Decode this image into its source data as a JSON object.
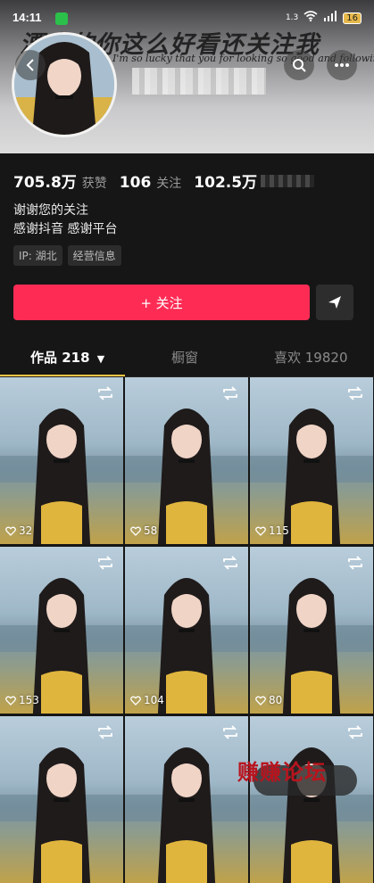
{
  "status_bar": {
    "time": "14:11",
    "signal": "1.3",
    "battery": "16"
  },
  "header": {
    "slogan": "漂亮的你这么好看还关注我",
    "slogan_en": "I'm so lucky that you for looking so good and following me"
  },
  "stats": [
    {
      "value": "705.8万",
      "label": "获赞"
    },
    {
      "value": "106",
      "label": "关注"
    },
    {
      "value": "102.5万",
      "label": ""
    }
  ],
  "bio": [
    "谢谢您的关注",
    "感谢抖音 感谢平台"
  ],
  "tags": [
    "IP: 湖北",
    "经营信息"
  ],
  "actions": {
    "follow_label": "+ 关注"
  },
  "tabs": [
    {
      "label": "作品 218",
      "active": true
    },
    {
      "label": "橱窗",
      "active": false
    },
    {
      "label": "喜欢 19820",
      "active": false
    }
  ],
  "videos": [
    "32",
    "58",
    "115",
    "153",
    "104",
    "80",
    "",
    "",
    ""
  ],
  "watermark": "赚赚论坛",
  "colors": {
    "accent": "#fe2c55",
    "tab_underline": "#f5c542"
  }
}
